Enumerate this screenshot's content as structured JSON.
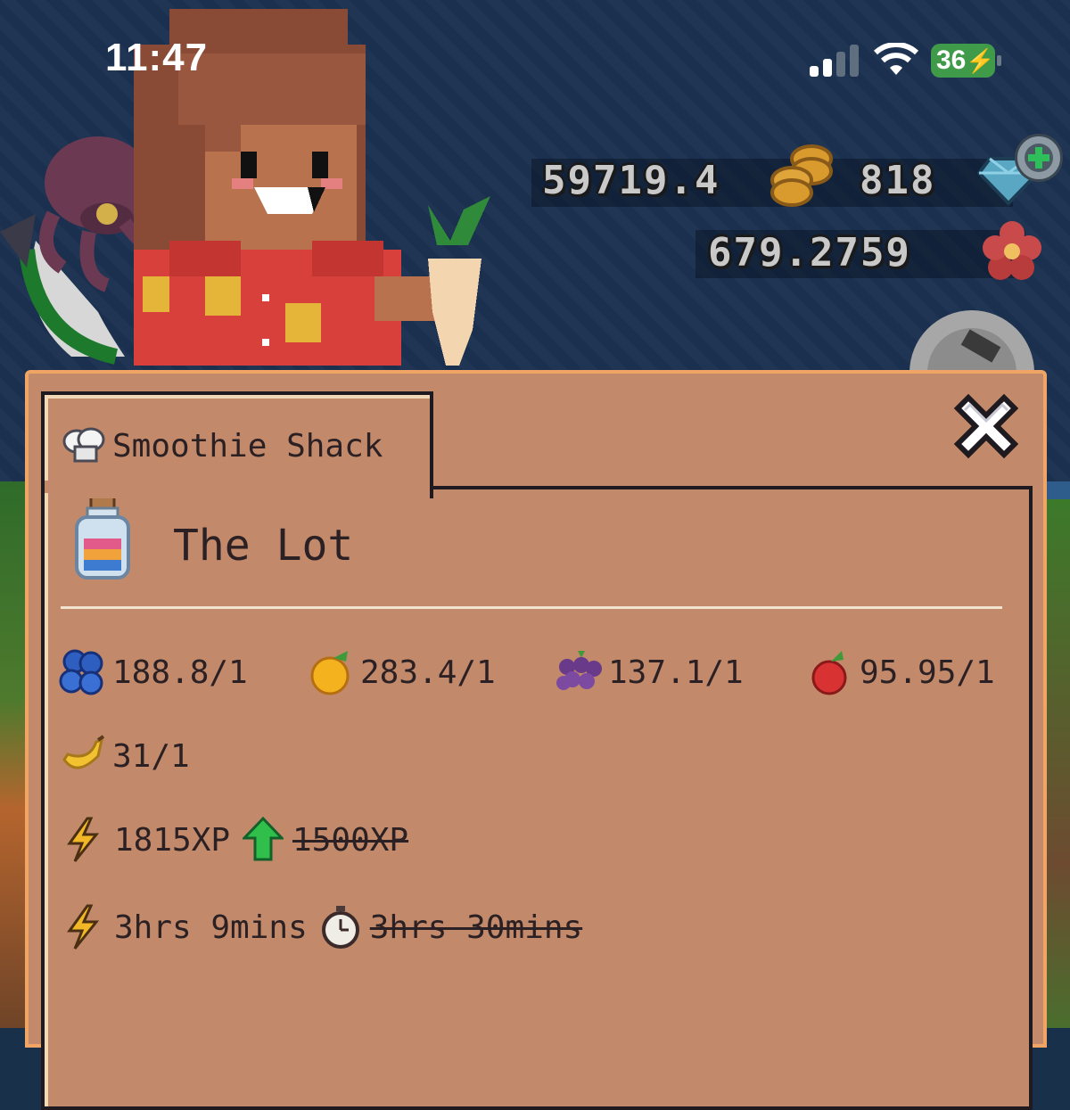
{
  "status_bar": {
    "time": "11:47",
    "battery": "36"
  },
  "hud": {
    "coins": "59719.4",
    "gems": "818",
    "flowers": "679.2759"
  },
  "panel": {
    "tab_label": "Smoothie Shack",
    "item_name": "The Lot",
    "ingredients": [
      {
        "icon": "blueberry-icon",
        "amount": "188.8/1"
      },
      {
        "icon": "orange-icon",
        "amount": "283.4/1"
      },
      {
        "icon": "grape-icon",
        "amount": "137.1/1"
      },
      {
        "icon": "apple-icon",
        "amount": "95.95/1"
      },
      {
        "icon": "banana-icon",
        "amount": "31/1"
      }
    ],
    "xp": {
      "boosted": "1815XP",
      "original": "1500XP"
    },
    "time": {
      "boosted": "3hrs 9mins",
      "original": "3hrs 30mins"
    }
  },
  "colors": {
    "panel_bg": "#c28a6a",
    "panel_border": "#f0a565",
    "text": "#2b2023",
    "background": "#1b3150"
  }
}
